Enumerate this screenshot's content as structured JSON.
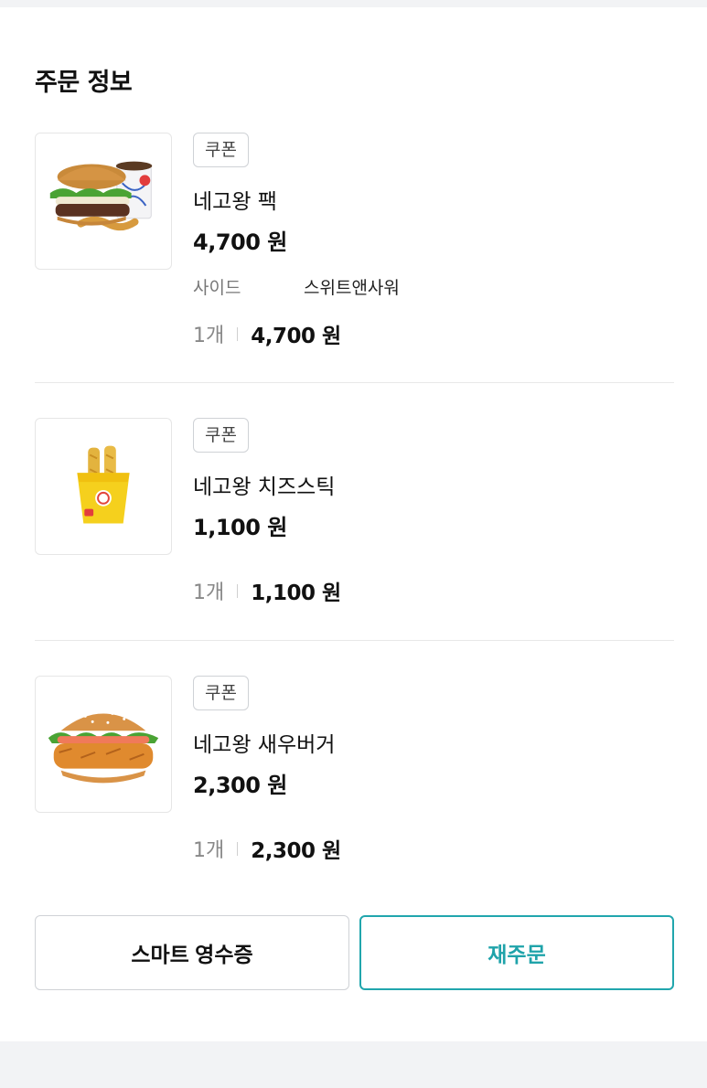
{
  "section": {
    "title": "주문 정보"
  },
  "items": [
    {
      "coupon": "쿠폰",
      "name": "네고왕 팩",
      "price": "4,700 원",
      "option_label": "사이드",
      "option_value": "스위트앤사워",
      "qty": "1개",
      "line_total": "4,700 원",
      "image": "burger-set-image"
    },
    {
      "coupon": "쿠폰",
      "name": "네고왕 치즈스틱",
      "price": "1,100 원",
      "qty": "1개",
      "line_total": "1,100 원",
      "image": "cheese-stick-image"
    },
    {
      "coupon": "쿠폰",
      "name": "네고왕 새우버거",
      "price": "2,300 원",
      "qty": "1개",
      "line_total": "2,300 원",
      "image": "shrimp-burger-image"
    }
  ],
  "actions": {
    "receipt_label": "스마트 영수증",
    "reorder_label": "재주문"
  },
  "colors": {
    "accent": "#1fa3aa",
    "border": "#cfd2d6"
  }
}
